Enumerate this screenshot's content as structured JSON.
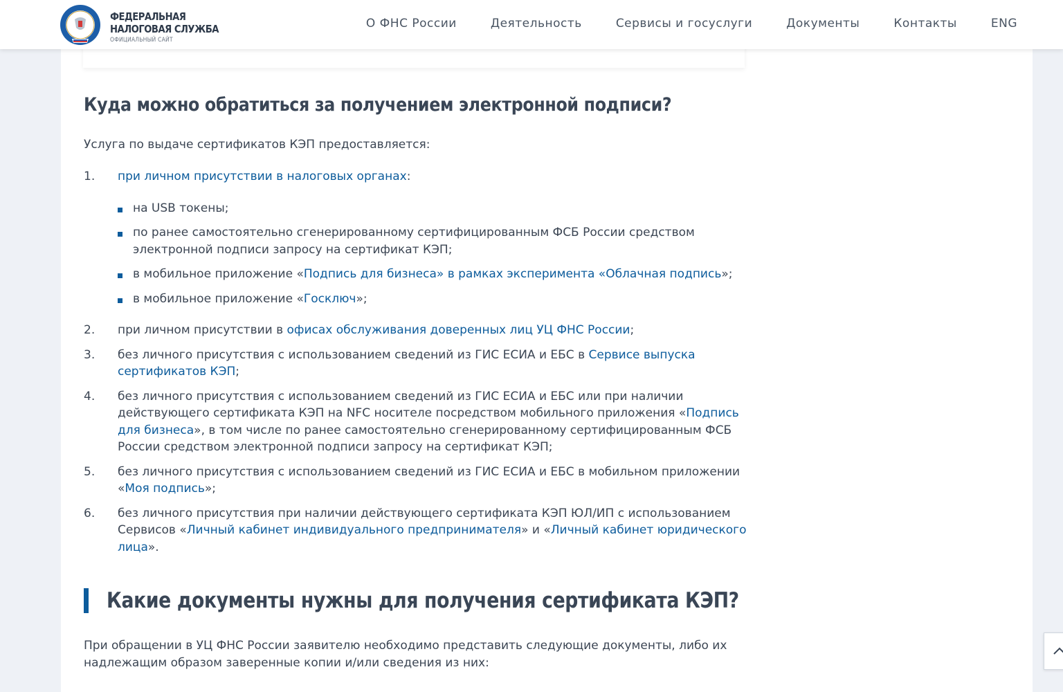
{
  "header": {
    "brand_line1": "ФЕДЕРАЛЬНАЯ",
    "brand_line2": "НАЛОГОВАЯ СЛУЖБА",
    "brand_sub": "ОФИЦИАЛЬНЫЙ САЙТ",
    "nav": [
      "О ФНС России",
      "Деятельность",
      "Сервисы и госуслуги",
      "Документы",
      "Контакты",
      "ENG"
    ]
  },
  "section1": {
    "title": "Куда можно обратиться за получением электронной подписи?",
    "intro": "Услуга по выдаче сертификатов КЭП предоставляется:",
    "items": {
      "i1": {
        "num": "1.",
        "link": "при личном присутствии в налоговых органах",
        "after": ":",
        "sub": {
          "s1": "на USB токены;",
          "s2": "по ранее самостоятельно сгенерированному сертифицированным ФСБ России средством электронной подписи запросу на сертификат КЭП;",
          "s3_pre": "в мобильное приложение «",
          "s3_link": "Подпись для бизнеса» в рамках эксперимента «Облачная подпись",
          "s3_post": "»;",
          "s4_pre": "в мобильное приложение «",
          "s4_link": "Госключ",
          "s4_post": "»;"
        }
      },
      "i2": {
        "num": "2.",
        "pre": "при личном присутствии в ",
        "link": "офисах обслуживания доверенных лиц УЦ ФНС России",
        "post": ";"
      },
      "i3": {
        "num": "3.",
        "pre": "без личного присутствия с использованием сведений из ГИС ЕСИА и ЕБС в ",
        "link": "Сервисе выпуска сертификатов КЭП",
        "post": ";"
      },
      "i4": {
        "num": "4.",
        "pre": "без личного присутствия с использованием сведений из ГИС ЕСИА и ЕБС или при наличии действующего сертификата КЭП на NFC носителе посредством мобильного приложения «",
        "link": "Подпись для бизнеса",
        "post": "», в том числе по ранее самостоятельно сгенерированному сертифицированным ФСБ России средством электронной подписи запросу на сертификат КЭП;"
      },
      "i5": {
        "num": "5.",
        "pre": "без личного присутствия с использованием сведений из ГИС ЕСИА и ЕБС в мобильном приложении «",
        "link": "Моя подпись",
        "post": "»;"
      },
      "i6": {
        "num": "6.",
        "pre": "без личного присутствия при наличии действующего сертификата КЭП ЮЛ/ИП с использованием Сервисов «",
        "link1": "Личный кабинет индивидуального предпринимателя",
        "mid": "» и «",
        "link2": "Личный кабинет юридического лица",
        "post": "»."
      }
    }
  },
  "section2": {
    "title": "Какие документы нужны для получения сертификата КЭП?",
    "intro": "При обращении в УЦ ФНС России заявителю необходимо представить следующие документы, либо их надлежащим образом заверенные копии и/или сведения из них:"
  },
  "colors": {
    "accent": "#0d5c9c",
    "text": "#3c4654",
    "heading": "#3a4656"
  },
  "icons": {
    "logo": "fns-emblem-logo",
    "scroll": "scroll-to-top-icon"
  }
}
